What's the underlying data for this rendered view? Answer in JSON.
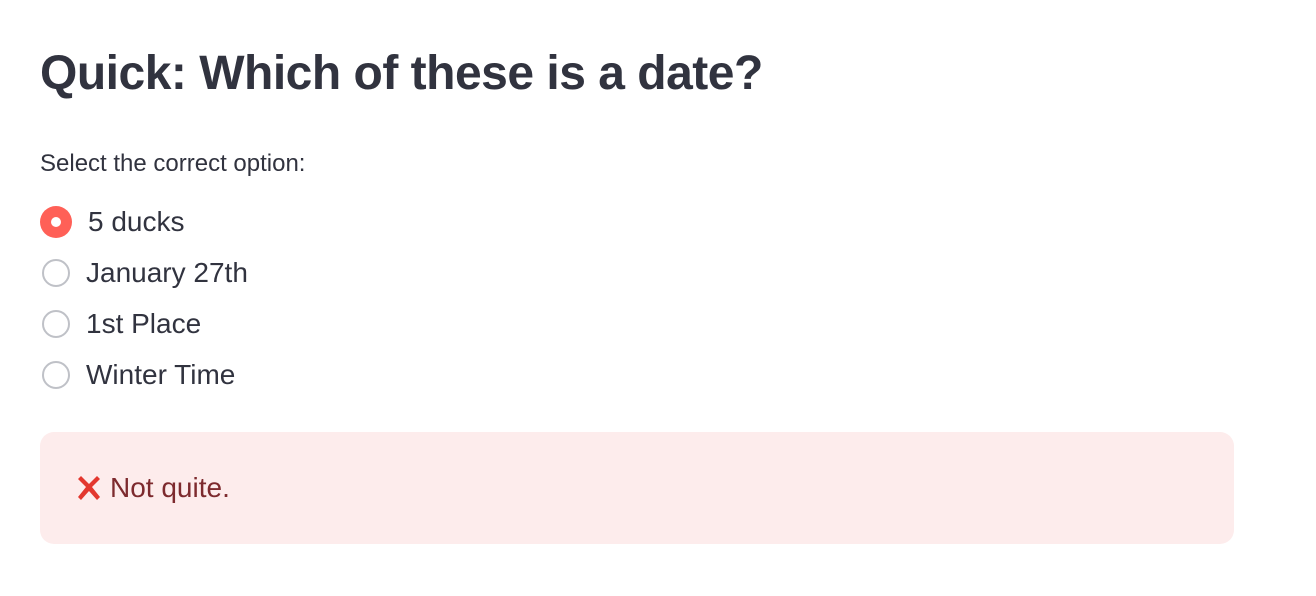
{
  "quiz": {
    "title": "Quick: Which of these is a date?",
    "prompt": "Select the correct option:",
    "options": [
      {
        "label": "5 ducks",
        "selected": true
      },
      {
        "label": "January 27th",
        "selected": false
      },
      {
        "label": "1st Place",
        "selected": false
      },
      {
        "label": "Winter Time",
        "selected": false
      }
    ]
  },
  "feedback": {
    "icon": "cross-mark-icon",
    "message": "Not quite."
  },
  "colors": {
    "text": "#31333f",
    "radio_selected": "#ff6057",
    "radio_unselected_border": "#bfc1c7",
    "error_background": "#fdecec",
    "error_text": "#7d2a2e",
    "error_icon": "#e3372e"
  }
}
